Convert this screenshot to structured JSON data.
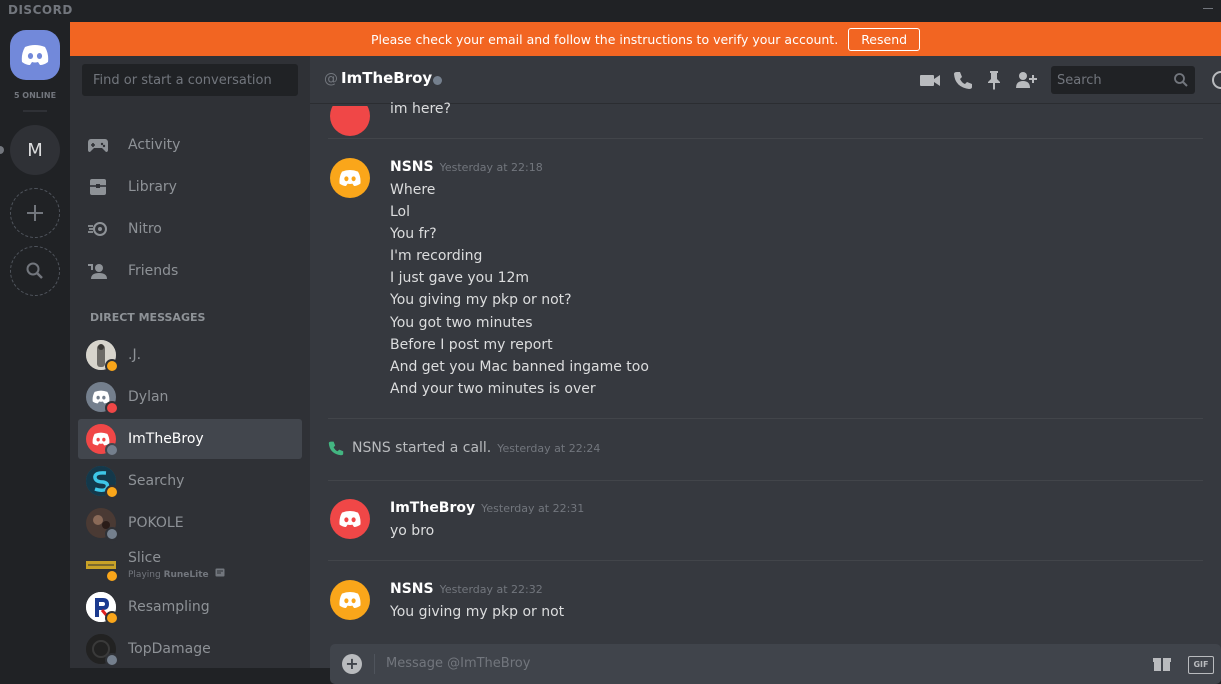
{
  "app": {
    "logo_text": "DISCORD"
  },
  "guilds": {
    "online_count": "5 ONLINE",
    "server_initial": "M"
  },
  "banner": {
    "text": "Please check your email and follow the instructions to verify your account.",
    "button": "Resend"
  },
  "sidebar": {
    "search_placeholder": "Find or start a conversation",
    "nav": [
      {
        "label": "Activity",
        "icon": "gamepad-icon"
      },
      {
        "label": "Library",
        "icon": "library-icon"
      },
      {
        "label": "Nitro",
        "icon": "nitro-icon"
      },
      {
        "label": "Friends",
        "icon": "friends-icon"
      }
    ],
    "dm_header": "DIRECT MESSAGES",
    "dms": [
      {
        "name": ".J.",
        "status_color": "#faa61a",
        "avatar_color": "#8e9297"
      },
      {
        "name": "Dylan",
        "status_color": "#f04747",
        "avatar_color": "#747f8d"
      },
      {
        "name": "ImTheBroy",
        "status_color": "#747f8d",
        "avatar_color": "#f04747"
      },
      {
        "name": "Searchy",
        "status_color": "#faa61a",
        "avatar_color": "#1a6b8a"
      },
      {
        "name": "POKOLE",
        "status_color": "#747f8d",
        "avatar_color": "#3a2e2a"
      },
      {
        "name": "Slice",
        "status_color": "#faa61a",
        "avatar_color": "#2a2a1a",
        "activity_prefix": "Playing ",
        "activity_game": "RuneLite"
      },
      {
        "name": "Resampling",
        "status_color": "#faa61a",
        "avatar_color": "#ffffff"
      },
      {
        "name": "TopDamage",
        "status_color": "#747f8d",
        "avatar_color": "#2b2b2b"
      }
    ]
  },
  "chat": {
    "at_symbol": "@",
    "title": "ImTheBroy",
    "search_placeholder": "Search",
    "colors": {
      "yellow_avatar": "#faa61a",
      "red_avatar": "#f04747",
      "call_green": "#43b581"
    },
    "top_line": "im here?",
    "groups": [
      {
        "author": "NSNS",
        "timestamp": "Yesterday at 22:18",
        "avatar_color": "#faa61a",
        "lines": [
          "Where",
          "Lol",
          "You fr?",
          "I'm recording",
          "I just gave you 12m",
          "You giving my pkp or not?",
          "You got two minutes",
          "Before I post my report",
          "And get you Mac banned ingame too",
          "And your two minutes is over"
        ]
      },
      {
        "author": "ImTheBroy",
        "timestamp": "Yesterday at 22:31",
        "avatar_color": "#f04747",
        "lines": [
          "yo bro"
        ]
      },
      {
        "author": "NSNS",
        "timestamp": "Yesterday at 22:32",
        "avatar_color": "#faa61a",
        "lines": [
          "You giving my pkp or not"
        ]
      }
    ],
    "call": {
      "text": "NSNS started a call.",
      "timestamp": "Yesterday at 22:24"
    },
    "input_placeholder": "Message @ImTheBroy",
    "gif_label": "GIF"
  }
}
